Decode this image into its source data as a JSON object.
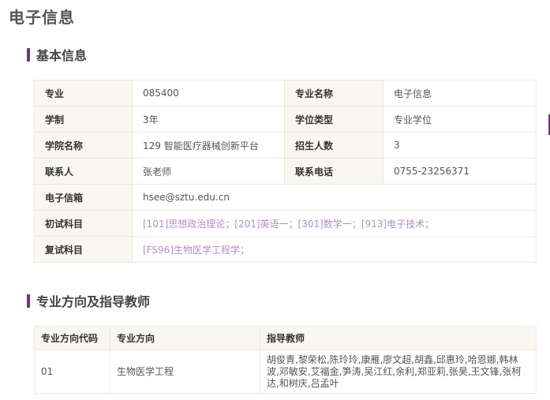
{
  "page_title": "电子信息",
  "sections": {
    "basic": "基本信息",
    "directions": "专业方向及指导教师"
  },
  "info": {
    "major_label": "专业",
    "major_value": "085400",
    "major_name_label": "专业名称",
    "major_name_value": "电子信息",
    "duration_label": "学制",
    "duration_value": "3年",
    "degree_type_label": "学位类型",
    "degree_type_value": "专业学位",
    "college_label": "学院名称",
    "college_value": "129 智能医疗器械创新平台",
    "enrollment_label": "招生人数",
    "enrollment_value": "3",
    "contact_label": "联系人",
    "contact_value": "张老师",
    "phone_label": "联系电话",
    "phone_value": "0755-23256371",
    "email_label": "电子信箱",
    "email_value": "hsee@sztu.edu.cn",
    "prelim_label": "初试科目",
    "prelim_value": "[101]思想政治理论；[201]英语一；[301]数学一；[913]电子技术；",
    "retest_label": "复试科目",
    "retest_value": "[FS96]生物医学工程学；"
  },
  "directions_table": {
    "headers": [
      "专业方向代码",
      "专业方向",
      "指导教师"
    ],
    "rows": [
      {
        "code": "01",
        "name": "生物医学工程",
        "advisors": "胡俊青,黎荣松,陈玲玲,康雁,廖文超,胡鑫,邱惠玲,哈恩娜,韩林波,邓敏安,艾福金,笋涛,吴江红,余利,郑亚莉,张昊,王文锋,张柯达,和树庆,吕孟叶"
      }
    ]
  },
  "colors": {
    "accent": "#7b2e8c",
    "link": "#b58bc8",
    "label_bg": "#faf7f2",
    "border": "#ede7de"
  }
}
